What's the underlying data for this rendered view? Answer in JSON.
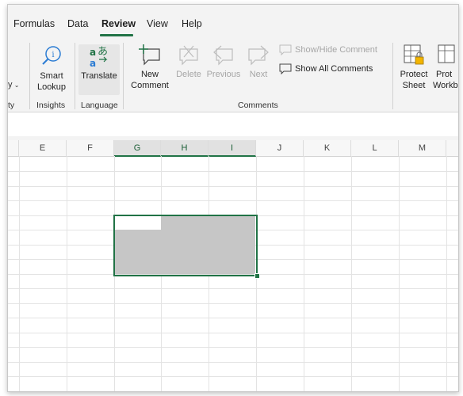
{
  "tabs": {
    "formulas": "Formulas",
    "data": "Data",
    "review": "Review",
    "view": "View",
    "help": "Help"
  },
  "ribbon": {
    "partial_left_top": "y",
    "partial_left_group": "ty",
    "smart_lookup": {
      "line1": "Smart",
      "line2": "Lookup"
    },
    "translate": "Translate",
    "new_comment": {
      "line1": "New",
      "line2": "Comment"
    },
    "delete": "Delete",
    "previous": "Previous",
    "next": "Next",
    "show_hide_comment": "Show/Hide Comment",
    "show_all_comments": "Show All Comments",
    "protect_sheet": {
      "line1": "Protect",
      "line2": "Sheet"
    },
    "protect_workbook_partial": {
      "line1": "Prot",
      "line2": "Workb"
    },
    "groups": {
      "insights": "Insights",
      "language": "Language",
      "comments": "Comments"
    }
  },
  "columns": [
    "E",
    "F",
    "G",
    "H",
    "I",
    "J",
    "K",
    "L",
    "M"
  ],
  "selected_columns": [
    "G",
    "H",
    "I"
  ],
  "colors": {
    "accent": "#217346",
    "selection_fill": "#c6c6c6",
    "ribbon_bg": "#f3f3f3"
  }
}
